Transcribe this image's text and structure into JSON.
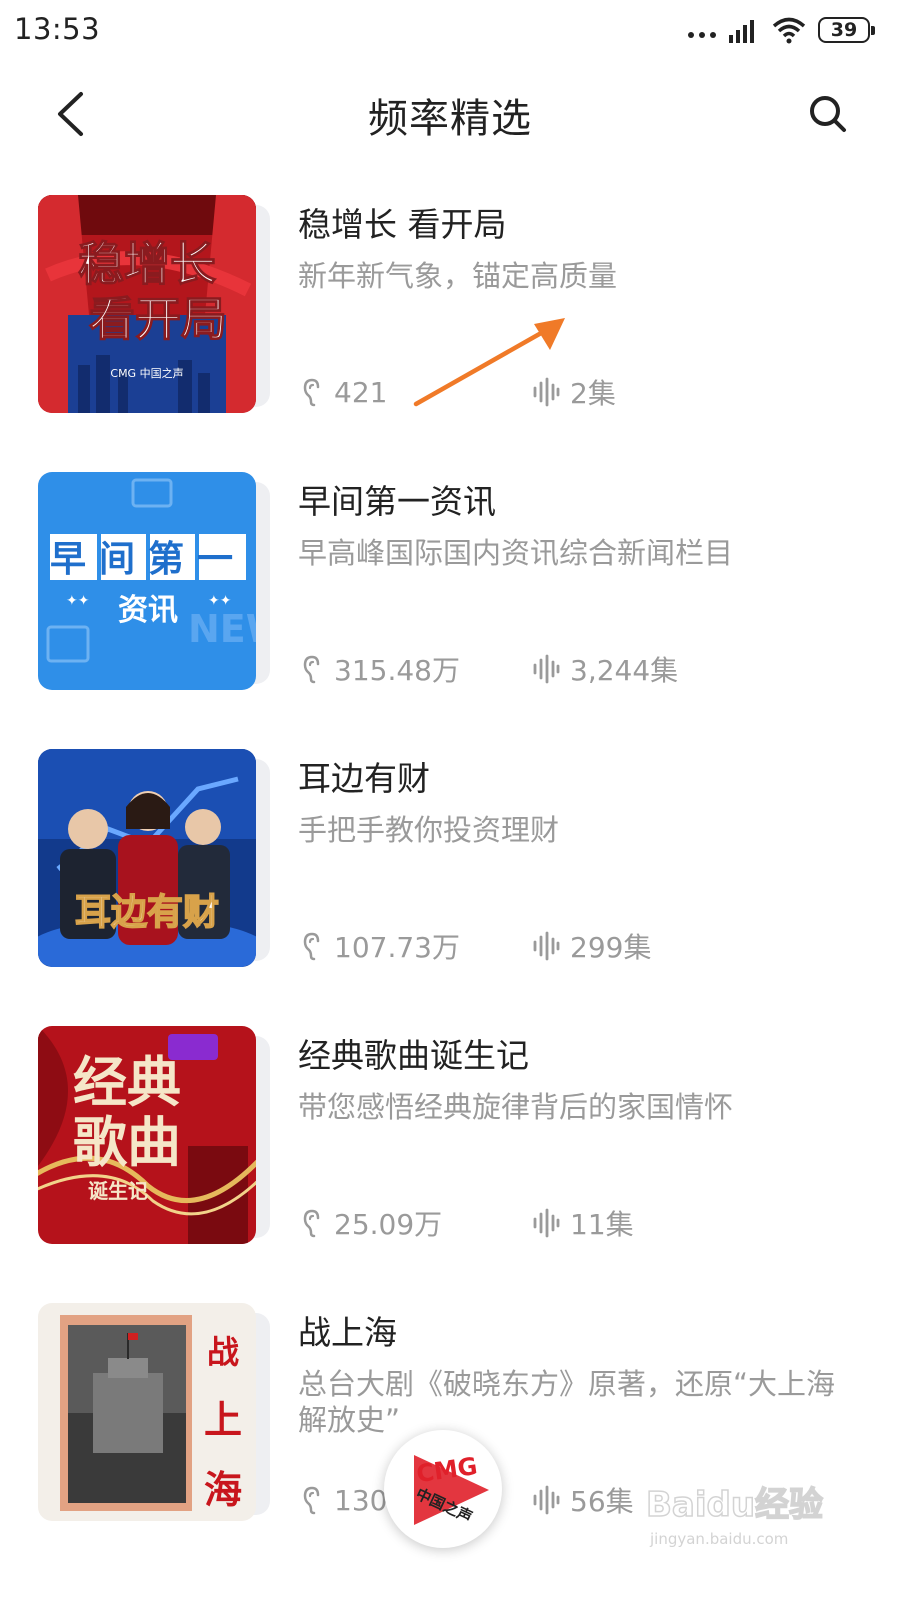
{
  "status_bar": {
    "time": "13:53",
    "battery": "39"
  },
  "header": {
    "title": "频率精选",
    "back_icon": "chevron-left-icon",
    "search_icon": "search-icon"
  },
  "items": [
    {
      "title": "稳增长 看开局",
      "desc": "新年新气象，锚定高质量",
      "plays": "421",
      "episodes": "2集",
      "cover_text": [
        "稳增长",
        "看开局"
      ],
      "cover_badge": "CMG 中国之声"
    },
    {
      "title": "早间第一资讯",
      "desc": "早高峰国际国内资讯综合新闻栏目",
      "plays": "315.48万",
      "episodes": "3,244集",
      "cover_text": [
        "早间第一",
        "资讯"
      ]
    },
    {
      "title": "耳边有财",
      "desc": "手把手教你投资理财",
      "plays": "107.73万",
      "episodes": "299集",
      "cover_text": [
        "耳边有财"
      ]
    },
    {
      "title": "经典歌曲诞生记",
      "desc": "带您感悟经典旋律背后的家国情怀",
      "plays": "25.09万",
      "episodes": "11集",
      "cover_text": [
        "经典",
        "歌曲",
        "诞生记"
      ]
    },
    {
      "title": "战上海",
      "desc": "总台大剧《破晓东方》原著，还原“大上海解放史”",
      "plays": "130",
      "episodes": "56集",
      "cover_text": [
        "战上海"
      ]
    }
  ],
  "player": {
    "label": "CMG",
    "sub": "中国之声"
  },
  "watermark": {
    "text": "Baidu经验",
    "sub": "jingyan.baidu.com"
  },
  "colors": {
    "text": "#222222",
    "muted": "#9a9a9a",
    "accent_arrow": "#f07a28",
    "red": "#d8262b",
    "blue": "#2f8fe8"
  }
}
